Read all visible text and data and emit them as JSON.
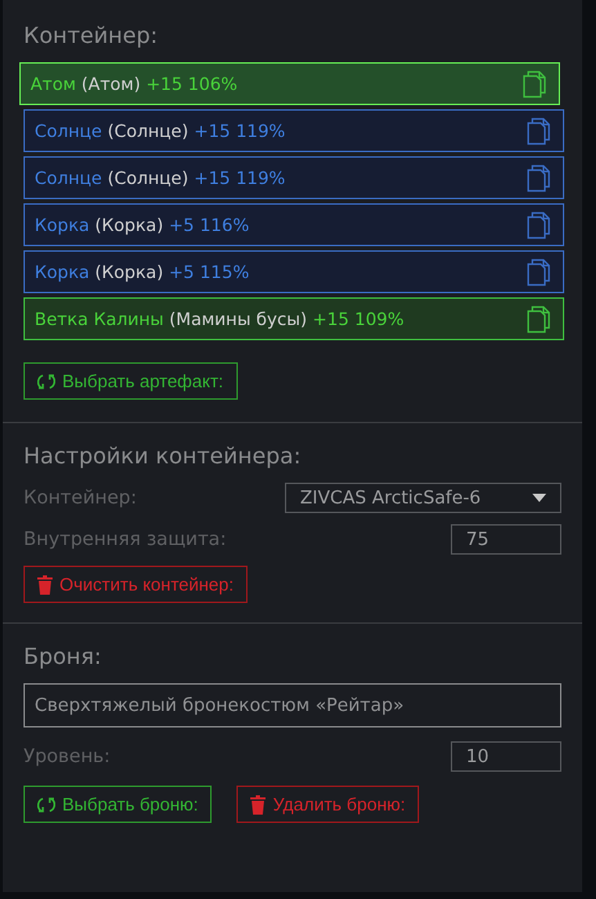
{
  "container": {
    "title": "Контейнер:",
    "items": [
      {
        "name": "Атом",
        "original": "(Атом)",
        "bonus": "+15 106%",
        "kind": "green",
        "selected": true
      },
      {
        "name": "Солнце",
        "original": "(Солнце)",
        "bonus": "+15 119%",
        "kind": "blue",
        "selected": false
      },
      {
        "name": "Солнце",
        "original": "(Солнце)",
        "bonus": "+15 119%",
        "kind": "blue",
        "selected": false
      },
      {
        "name": "Корка",
        "original": "(Корка)",
        "bonus": "+5 116%",
        "kind": "blue",
        "selected": false
      },
      {
        "name": "Корка",
        "original": "(Корка)",
        "bonus": "+5 115%",
        "kind": "blue",
        "selected": false
      },
      {
        "name": "Ветка Калины",
        "original": "(Мамины бусы)",
        "bonus": "+15 109%",
        "kind": "green",
        "selected": false
      }
    ],
    "select_button": "Выбрать артефакт:"
  },
  "settings": {
    "title": "Настройки контейнера:",
    "container_label": "Контейнер:",
    "container_value": "ZIVCAS ArcticSafe-6",
    "protection_label": "Внутренняя защита:",
    "protection_value": "75",
    "clear_button": "Очистить контейнер:"
  },
  "armor": {
    "title": "Броня:",
    "name_value": "Сверхтяжелый бронекостюм «Рейтар»",
    "level_label": "Уровень:",
    "level_value": "10",
    "select_button": "Выбрать броню:",
    "delete_button": "Удалить броню:"
  }
}
